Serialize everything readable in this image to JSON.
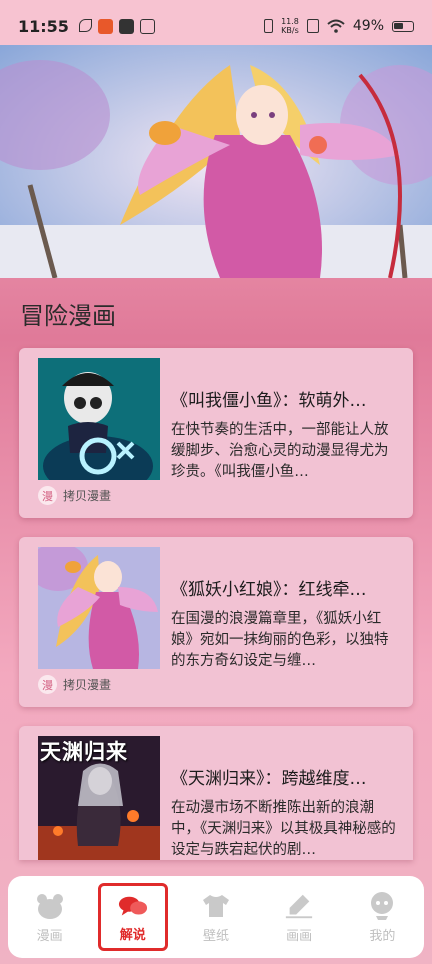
{
  "status_bar": {
    "time": "11:55",
    "net_speed_value": "11.8",
    "net_speed_unit": "KB/s",
    "battery": "49%"
  },
  "section": {
    "title": "冒险漫画"
  },
  "cards": [
    {
      "title": "《叫我僵小鱼》：软萌外…",
      "desc": "在快节奏的生活中，一部能让人放缓脚步、治愈心灵的动漫显得尤为珍贵。《叫我僵小鱼…",
      "source_badge": "漫",
      "source": "拷贝漫畫"
    },
    {
      "title": "《狐妖小红娘》：红线牵…",
      "desc": "在国漫的浪漫篇章里，《狐妖小红娘》宛如一抹绚丽的色彩，以独特的东方奇幻设定与缠…",
      "source_badge": "漫",
      "source": "拷贝漫畫"
    },
    {
      "title": "《天渊归来》：跨越维度…",
      "desc": "在动漫市场不断推陈出新的浪潮中，《天渊归来》以其极具神秘感的设定与跌宕起伏的剧…",
      "thumb_title": "天渊归来"
    }
  ],
  "tabs": [
    {
      "label": "漫画",
      "icon": "bear-icon"
    },
    {
      "label": "解说",
      "icon": "chat-bubbles-icon",
      "active": true
    },
    {
      "label": "壁纸",
      "icon": "tshirt-icon"
    },
    {
      "label": "画画",
      "icon": "pen-icon"
    },
    {
      "label": "我的",
      "icon": "profile-icon"
    }
  ],
  "colors": {
    "accent": "#e02b2b",
    "card_bg": "#f2c2d3"
  }
}
